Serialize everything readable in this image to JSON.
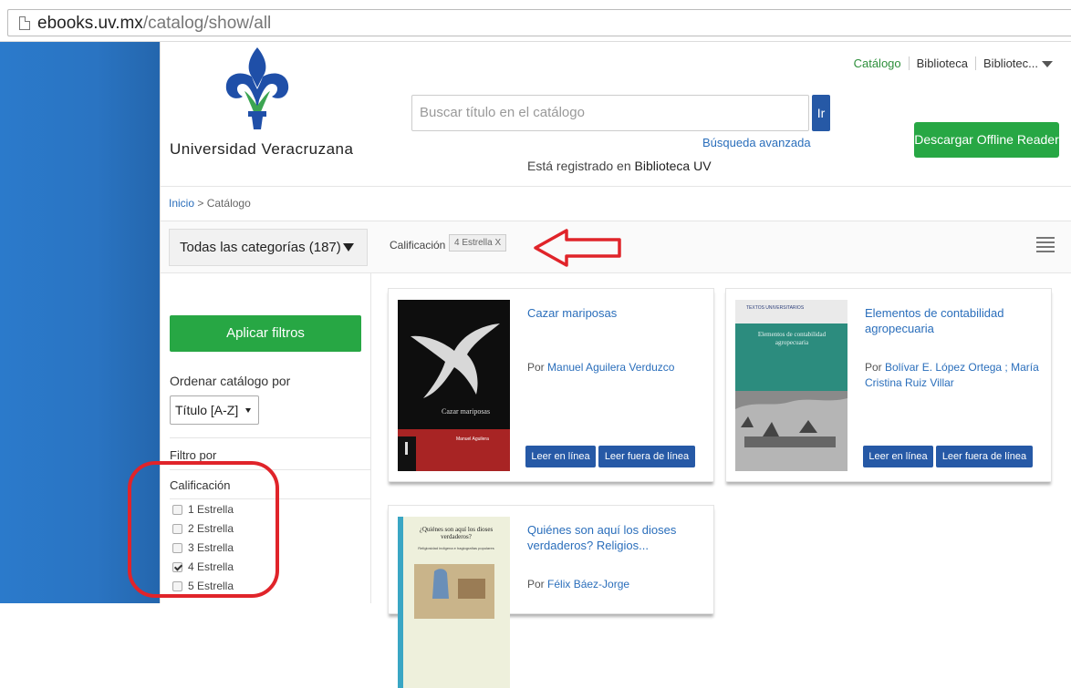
{
  "browser": {
    "url_host": "ebooks.uv.mx",
    "url_path": "/catalog/show/all"
  },
  "header": {
    "university_name": "Universidad Veracruzana",
    "nav": [
      "Catálogo",
      "Biblioteca",
      "Bibliotec..."
    ],
    "search_placeholder": "Buscar título en el catálogo",
    "search_button": "Ir",
    "advanced_search": "Búsqueda avanzada",
    "registered_prefix": "Está registrado en",
    "registered_library": "Biblioteca UV",
    "download_button": "Descargar Offline Reader"
  },
  "breadcrumb": {
    "home": "Inicio",
    "separator": ">",
    "current": "Catálogo"
  },
  "filterbar": {
    "categories_dropdown": "Todas las categorías (187)",
    "active_filter_label": "Calificación :",
    "active_filter_tag": "4 Estrella X"
  },
  "sidebar": {
    "apply_button": "Aplicar filtros",
    "order_label": "Ordenar catálogo por",
    "order_value": "Título [A-Z]",
    "filter_label": "Filtro por",
    "rating_heading": "Calificación",
    "rating_options": [
      {
        "label": "1 Estrella",
        "checked": false
      },
      {
        "label": "2 Estrella",
        "checked": false
      },
      {
        "label": "3 Estrella",
        "checked": false
      },
      {
        "label": "4 Estrella",
        "checked": true
      },
      {
        "label": "5 Estrella",
        "checked": false
      }
    ]
  },
  "books": [
    {
      "title": "Cazar mariposas",
      "by_prefix": "Por",
      "author": "Manuel Aguilera Verduzco",
      "cover_title": "Cazar mariposas",
      "cover_author": "Manuel Aguilera",
      "read_online": "Leer en línea",
      "read_offline": "Leer fuera de línea"
    },
    {
      "title": "Elementos de contabilidad agropecuaria",
      "by_prefix": "Por",
      "author": "Bolívar E. López Ortega ; María Cristina Ruiz Villar",
      "cover_title": "Elementos de contabilidad agropecuaria",
      "cover_series": "TEXTOS UNIVERSITARIOS",
      "read_online": "Leer en línea",
      "read_offline": "Leer fuera de línea"
    },
    {
      "title": "Quiénes son aquí los dioses verdaderos? Religios...",
      "by_prefix": "Por",
      "author": "Félix Báez-Jorge",
      "cover_title": "¿Quiénes son aquí los dioses verdaderos?",
      "cover_subtitle": "Religiosidad indígena e hagiografías populares"
    }
  ],
  "colors": {
    "blue_bar": "#2a74c2",
    "green_button": "#27a744",
    "blue_button": "#2659a6",
    "annotation_red": "#e0242a",
    "link_blue": "#2a6ebb"
  },
  "icons": [
    "page-icon",
    "caret-down-icon",
    "list-view-icon",
    "checkbox-icon",
    "red-arrow-annotation"
  ]
}
